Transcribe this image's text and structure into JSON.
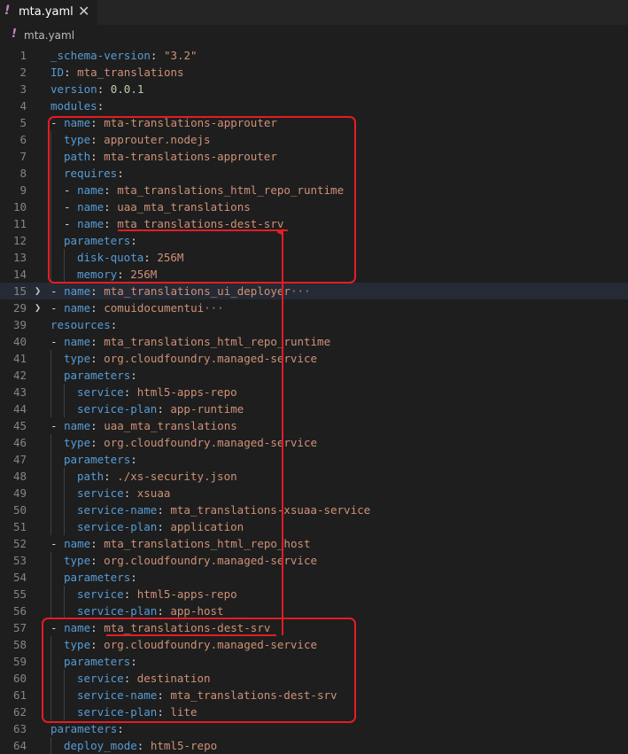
{
  "tab": {
    "icon": "!",
    "title": "mta.yaml",
    "close": "✕"
  },
  "breadcrumb": {
    "icon": "!",
    "title": "mta.yaml"
  },
  "lines": [
    {
      "n": "1",
      "indent": 0,
      "parts": [
        [
          "k",
          "_schema-version"
        ],
        [
          "p",
          ": "
        ],
        [
          "s",
          "\"3.2\""
        ]
      ]
    },
    {
      "n": "2",
      "indent": 0,
      "parts": [
        [
          "k",
          "ID"
        ],
        [
          "p",
          ": "
        ],
        [
          "s",
          "mta_translations"
        ]
      ]
    },
    {
      "n": "3",
      "indent": 0,
      "parts": [
        [
          "k",
          "version"
        ],
        [
          "p",
          ": "
        ],
        [
          "n",
          "0.0.1"
        ]
      ]
    },
    {
      "n": "4",
      "indent": 0,
      "parts": [
        [
          "k",
          "modules"
        ],
        [
          "p",
          ":"
        ]
      ]
    },
    {
      "n": "5",
      "indent": 0,
      "parts": [
        [
          "p",
          "- "
        ],
        [
          "k",
          "name"
        ],
        [
          "p",
          ": "
        ],
        [
          "s",
          "mta-translations-approuter"
        ]
      ]
    },
    {
      "n": "6",
      "indent": 1,
      "parts": [
        [
          "k",
          "type"
        ],
        [
          "p",
          ": "
        ],
        [
          "s",
          "approuter.nodejs"
        ]
      ]
    },
    {
      "n": "7",
      "indent": 1,
      "parts": [
        [
          "k",
          "path"
        ],
        [
          "p",
          ": "
        ],
        [
          "s",
          "mta-translations-approuter"
        ]
      ]
    },
    {
      "n": "8",
      "indent": 1,
      "parts": [
        [
          "k",
          "requires"
        ],
        [
          "p",
          ":"
        ]
      ]
    },
    {
      "n": "9",
      "indent": 1,
      "parts": [
        [
          "p",
          "- "
        ],
        [
          "k",
          "name"
        ],
        [
          "p",
          ": "
        ],
        [
          "s",
          "mta_translations_html_repo_runtime"
        ]
      ]
    },
    {
      "n": "10",
      "indent": 1,
      "parts": [
        [
          "p",
          "- "
        ],
        [
          "k",
          "name"
        ],
        [
          "p",
          ": "
        ],
        [
          "s",
          "uaa_mta_translations"
        ]
      ]
    },
    {
      "n": "11",
      "indent": 1,
      "parts": [
        [
          "p",
          "- "
        ],
        [
          "k",
          "name"
        ],
        [
          "p",
          ": "
        ],
        [
          "s",
          "mta_translations-dest-srv"
        ]
      ]
    },
    {
      "n": "12",
      "indent": 1,
      "parts": [
        [
          "k",
          "parameters"
        ],
        [
          "p",
          ":"
        ]
      ]
    },
    {
      "n": "13",
      "indent": 2,
      "parts": [
        [
          "k",
          "disk-quota"
        ],
        [
          "p",
          ": "
        ],
        [
          "s",
          "256M"
        ]
      ]
    },
    {
      "n": "14",
      "indent": 2,
      "parts": [
        [
          "k",
          "memory"
        ],
        [
          "p",
          ": "
        ],
        [
          "s",
          "256M"
        ]
      ]
    },
    {
      "n": "15",
      "indent": 0,
      "fold": true,
      "cur": true,
      "parts": [
        [
          "p",
          "- "
        ],
        [
          "k",
          "name"
        ],
        [
          "p",
          ": "
        ],
        [
          "s",
          "mta_translations_ui_deployer"
        ],
        [
          "ell",
          "···"
        ]
      ]
    },
    {
      "n": "29",
      "indent": 0,
      "fold": true,
      "parts": [
        [
          "p",
          "- "
        ],
        [
          "k",
          "name"
        ],
        [
          "p",
          ": "
        ],
        [
          "s",
          "comuidocumentui"
        ],
        [
          "ell",
          "···"
        ]
      ]
    },
    {
      "n": "39",
      "indent": 0,
      "parts": [
        [
          "k",
          "resources"
        ],
        [
          "p",
          ":"
        ]
      ]
    },
    {
      "n": "40",
      "indent": 0,
      "parts": [
        [
          "p",
          "- "
        ],
        [
          "k",
          "name"
        ],
        [
          "p",
          ": "
        ],
        [
          "s",
          "mta_translations_html_repo_runtime"
        ]
      ]
    },
    {
      "n": "41",
      "indent": 1,
      "parts": [
        [
          "k",
          "type"
        ],
        [
          "p",
          ": "
        ],
        [
          "s",
          "org.cloudfoundry.managed-service"
        ]
      ]
    },
    {
      "n": "42",
      "indent": 1,
      "parts": [
        [
          "k",
          "parameters"
        ],
        [
          "p",
          ":"
        ]
      ]
    },
    {
      "n": "43",
      "indent": 2,
      "parts": [
        [
          "k",
          "service"
        ],
        [
          "p",
          ": "
        ],
        [
          "s",
          "html5-apps-repo"
        ]
      ]
    },
    {
      "n": "44",
      "indent": 2,
      "parts": [
        [
          "k",
          "service-plan"
        ],
        [
          "p",
          ": "
        ],
        [
          "s",
          "app-runtime"
        ]
      ]
    },
    {
      "n": "45",
      "indent": 0,
      "parts": [
        [
          "p",
          "- "
        ],
        [
          "k",
          "name"
        ],
        [
          "p",
          ": "
        ],
        [
          "s",
          "uaa_mta_translations"
        ]
      ]
    },
    {
      "n": "46",
      "indent": 1,
      "parts": [
        [
          "k",
          "type"
        ],
        [
          "p",
          ": "
        ],
        [
          "s",
          "org.cloudfoundry.managed-service"
        ]
      ]
    },
    {
      "n": "47",
      "indent": 1,
      "parts": [
        [
          "k",
          "parameters"
        ],
        [
          "p",
          ":"
        ]
      ]
    },
    {
      "n": "48",
      "indent": 2,
      "parts": [
        [
          "k",
          "path"
        ],
        [
          "p",
          ": "
        ],
        [
          "s",
          "./xs-security.json"
        ]
      ]
    },
    {
      "n": "49",
      "indent": 2,
      "parts": [
        [
          "k",
          "service"
        ],
        [
          "p",
          ": "
        ],
        [
          "s",
          "xsuaa"
        ]
      ]
    },
    {
      "n": "50",
      "indent": 2,
      "parts": [
        [
          "k",
          "service-name"
        ],
        [
          "p",
          ": "
        ],
        [
          "s",
          "mta_translations-xsuaa-service"
        ]
      ]
    },
    {
      "n": "51",
      "indent": 2,
      "parts": [
        [
          "k",
          "service-plan"
        ],
        [
          "p",
          ": "
        ],
        [
          "s",
          "application"
        ]
      ]
    },
    {
      "n": "52",
      "indent": 0,
      "parts": [
        [
          "p",
          "- "
        ],
        [
          "k",
          "name"
        ],
        [
          "p",
          ": "
        ],
        [
          "s",
          "mta_translations_html_repo_host"
        ]
      ]
    },
    {
      "n": "53",
      "indent": 1,
      "parts": [
        [
          "k",
          "type"
        ],
        [
          "p",
          ": "
        ],
        [
          "s",
          "org.cloudfoundry.managed-service"
        ]
      ]
    },
    {
      "n": "54",
      "indent": 1,
      "parts": [
        [
          "k",
          "parameters"
        ],
        [
          "p",
          ":"
        ]
      ]
    },
    {
      "n": "55",
      "indent": 2,
      "parts": [
        [
          "k",
          "service"
        ],
        [
          "p",
          ": "
        ],
        [
          "s",
          "html5-apps-repo"
        ]
      ]
    },
    {
      "n": "56",
      "indent": 2,
      "parts": [
        [
          "k",
          "service-plan"
        ],
        [
          "p",
          ": "
        ],
        [
          "s",
          "app-host"
        ]
      ]
    },
    {
      "n": "57",
      "indent": 0,
      "parts": [
        [
          "p",
          "- "
        ],
        [
          "k",
          "name"
        ],
        [
          "p",
          ": "
        ],
        [
          "s",
          "mta_translations-dest-srv"
        ]
      ]
    },
    {
      "n": "58",
      "indent": 1,
      "parts": [
        [
          "k",
          "type"
        ],
        [
          "p",
          ": "
        ],
        [
          "s",
          "org.cloudfoundry.managed-service"
        ]
      ]
    },
    {
      "n": "59",
      "indent": 1,
      "parts": [
        [
          "k",
          "parameters"
        ],
        [
          "p",
          ":"
        ]
      ]
    },
    {
      "n": "60",
      "indent": 2,
      "parts": [
        [
          "k",
          "service"
        ],
        [
          "p",
          ": "
        ],
        [
          "s",
          "destination"
        ]
      ]
    },
    {
      "n": "61",
      "indent": 2,
      "parts": [
        [
          "k",
          "service-name"
        ],
        [
          "p",
          ": "
        ],
        [
          "s",
          "mta_translations-dest-srv"
        ]
      ]
    },
    {
      "n": "62",
      "indent": 2,
      "parts": [
        [
          "k",
          "service-plan"
        ],
        [
          "p",
          ": "
        ],
        [
          "s",
          "lite"
        ]
      ]
    },
    {
      "n": "63",
      "indent": 0,
      "parts": [
        [
          "k",
          "parameters"
        ],
        [
          "p",
          ":"
        ]
      ]
    },
    {
      "n": "64",
      "indent": 1,
      "parts": [
        [
          "k",
          "deploy_mode"
        ],
        [
          "p",
          ": "
        ],
        [
          "s",
          "html5-repo"
        ]
      ]
    }
  ]
}
